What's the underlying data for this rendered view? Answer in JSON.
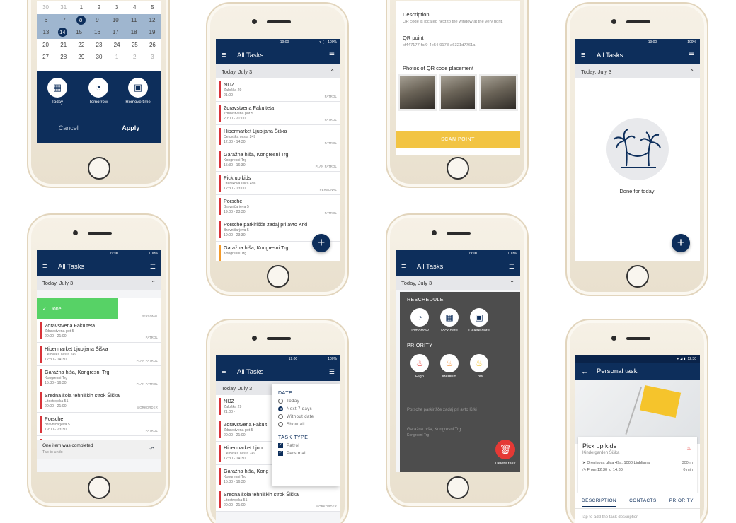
{
  "colors": {
    "primary": "#0d2e5b",
    "accent_red": "#d9343a",
    "accent_orange": "#f39a2b",
    "done_green": "#57d266",
    "scan_yellow": "#f2c443",
    "delete_red": "#e53935"
  },
  "status": {
    "time": "19:00",
    "battery": "100%",
    "time2": "12:30"
  },
  "common": {
    "all_tasks": "All Tasks",
    "today_header": "Today, July 3"
  },
  "calendar": {
    "rows": [
      [
        "30",
        "31",
        "1",
        "2",
        "3",
        "4",
        "5"
      ],
      [
        "6",
        "7",
        "8",
        "9",
        "10",
        "11",
        "12"
      ],
      [
        "13",
        "14",
        "15",
        "16",
        "17",
        "18",
        "19"
      ],
      [
        "20",
        "21",
        "22",
        "23",
        "24",
        "25",
        "26"
      ],
      [
        "27",
        "28",
        "29",
        "30",
        "1",
        "2",
        "3"
      ]
    ],
    "quick": [
      {
        "label": "Today",
        "icon": "calendar-icon"
      },
      {
        "label": "Tomorrow",
        "icon": "clock-forward-icon"
      },
      {
        "label": "Remove time",
        "icon": "calendar-remove-icon"
      }
    ],
    "cancel": "Cancel",
    "apply": "Apply"
  },
  "tasks_main": [
    {
      "title": "NIJZ",
      "addr": "Zaloška 29",
      "time": "21:00 -",
      "tag": "PATROL"
    },
    {
      "title": "Zdravstvena Fakulteta",
      "addr": "Zdravstvena pot 5",
      "time": "20:00 - 21:00",
      "tag": "PATROL"
    },
    {
      "title": "Hipermarket Ljubljana Šiška",
      "addr": "Celovška cesta 249",
      "time": "12:30 - 14:30",
      "tag": "PATROL"
    },
    {
      "title": "Garažna hiša, Kongresni Trg",
      "addr": "Kongresni Trg",
      "time": "15:30 - 16:30",
      "tag": "PLAN PATROL"
    },
    {
      "title": "Pick up kids",
      "addr": "Drenikova ulica 49a",
      "time": "12:30 - 13:00",
      "tag": "PERSONAL"
    },
    {
      "title": "Porsche",
      "addr": "Bravničarjeva 5",
      "time": "19:00 - 23:30",
      "tag": "PATROL"
    },
    {
      "title": "Porsche parkirišče zadaj pri avto Krki",
      "addr": "Bravničarjeva 5",
      "time": "19:00 - 23:30",
      "tag": ""
    },
    {
      "title": "Garažna hiša, Kongresni Trg",
      "addr": "Kongresni Trg",
      "time": "",
      "tag": "",
      "orange": true
    }
  ],
  "qr": {
    "desc_label": "Description",
    "desc_value": "QR code is located next to the window at the very right.",
    "point_label": "QR point",
    "point_value": "cf447177-faf9-4e54-9178-a6321d7761a",
    "photos_label": "Photos of QR code placement",
    "scan": "SCAN POINT"
  },
  "done": {
    "text": "Done for today!",
    "icon": "palm-hammock-icon"
  },
  "swipe": {
    "done_label": "Done",
    "first_tag": "PERSONAL",
    "tasks": [
      {
        "title": "Zdravstvena Fakulteta",
        "addr": "Zdravstvena pot 5",
        "time": "20:00 - 21:00",
        "tag": "PATROL"
      },
      {
        "title": "Hipermarket Ljubljana Šiška",
        "addr": "Celovška cesta 249",
        "time": "12:30 - 14:30",
        "tag": "PLAN PATROL"
      },
      {
        "title": "Garažna hiša, Kongresni Trg",
        "addr": "Kongresni Trg",
        "time": "15:30 - 16:30",
        "tag": "PLAN PATROL"
      },
      {
        "title": "Sredna šola tehniških strok Šiška",
        "addr": "Litostrojska 51",
        "time": "20:00 - 21:00",
        "tag": "WORKORDER"
      },
      {
        "title": "Porsche",
        "addr": "Bravničarjeva 5",
        "time": "19:00 - 23:30",
        "tag": "PATROL"
      },
      {
        "title": "Porsche parkirišče zadaj pri avto Krki",
        "addr": "Bravničarjeva 5",
        "time": "",
        "tag": ""
      }
    ],
    "snack_msg": "One item was completed",
    "snack_undo": "Tap to undo"
  },
  "filter": {
    "date_h": "DATE",
    "date_opts": [
      "Today",
      "Next 7 days",
      "Without date",
      "Show all"
    ],
    "type_h": "TASK TYPE",
    "type_opts": [
      "Patrol",
      "Personal"
    ],
    "tasks": [
      {
        "title": "NIJZ",
        "addr": "Zaloška 29",
        "time": "21:00 -"
      },
      {
        "title": "Zdravstvena Fakult",
        "addr": "Zdravstvena pot 5",
        "time": "20:00 - 21:00"
      },
      {
        "title": "Hipermarket Ljubl",
        "addr": "Celovška cesta 249",
        "time": "12:30 - 14:30"
      },
      {
        "title": "Garažna hiša, Kong",
        "addr": "Kongresni Trg",
        "time": "15:30 - 16:30",
        "tag": "PLAN PATROL"
      },
      {
        "title": "Sredna šola tehniških strok Šiška",
        "addr": "Litostrojska 51",
        "time": "20:00 - 21:00",
        "tag": "WORKORDER"
      }
    ]
  },
  "reschedule": {
    "title": "RESCHEDULE",
    "opts": [
      {
        "label": "Tomorrow",
        "icon": "clock-forward-icon"
      },
      {
        "label": "Pick date",
        "icon": "calendar-pick-icon"
      },
      {
        "label": "Delete date",
        "icon": "calendar-remove-icon"
      }
    ],
    "priority_title": "PRIORITY",
    "priorities": [
      {
        "label": "High",
        "color": "#e53935"
      },
      {
        "label": "Medium",
        "color": "#f5923a"
      },
      {
        "label": "Low",
        "color": "#f5c42c"
      }
    ],
    "delete": "Delete task",
    "bg_tasks": [
      "Porsche parkirišče zadaj pri avto Krki",
      "Garažna hiša, Kongresni Trg",
      "Kongresni Trg"
    ]
  },
  "personal": {
    "header": "Personal task",
    "title": "Pick up kids",
    "subtitle": "Kindergarden Šiška",
    "address": "Drenikova ulica 49a, 1000 Ljubljana",
    "distance": "300 m",
    "time": "From 12:30 to 14:30",
    "duration": "0 min",
    "tabs": [
      "DESCRIPTION",
      "CONTACTS",
      "PRIORITY"
    ],
    "tap_desc": "Tap to add the task description"
  }
}
